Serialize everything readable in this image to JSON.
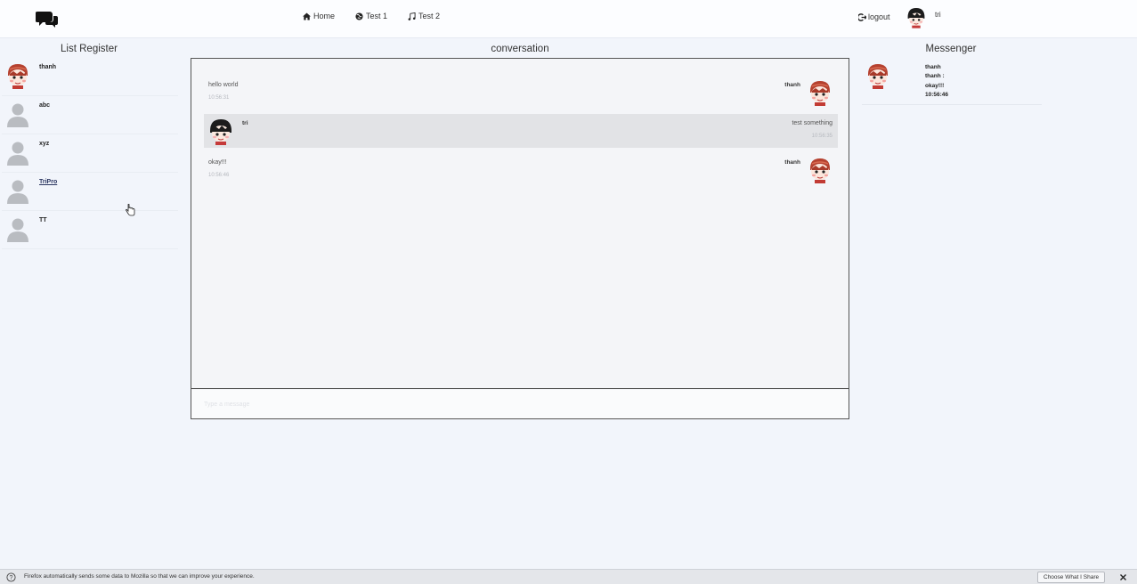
{
  "navbar": {
    "brand_icon": "chat-bubbles-icon",
    "links": [
      {
        "label": "Home",
        "icon": "home-icon"
      },
      {
        "label": "Test 1",
        "icon": "globe-icon"
      },
      {
        "label": "Test 2",
        "icon": "music-icon"
      }
    ],
    "logout_label": "logout",
    "user_name": "tri"
  },
  "list_register": {
    "title": "List Register",
    "items": [
      {
        "name": "thanh",
        "avatar": "cartoon-avatar-red"
      },
      {
        "name": "abc",
        "avatar": "default-user-icon"
      },
      {
        "name": "xyz",
        "avatar": "default-user-icon"
      },
      {
        "name": "TriPro",
        "avatar": "default-user-icon"
      },
      {
        "name": "TT",
        "avatar": "default-user-icon"
      }
    ]
  },
  "conversation": {
    "title": "conversation",
    "messages": [
      {
        "text": "hello world",
        "time": "10:56:31",
        "sender": "thanh",
        "side": "right-avatar"
      },
      {
        "text": "test something",
        "time": "10:56:35",
        "sender": "tri",
        "side": "left-avatar"
      },
      {
        "text": "okay!!!",
        "time": "10:56:46",
        "sender": "thanh",
        "side": "right-avatar"
      }
    ],
    "input_placeholder": "Type a message"
  },
  "messenger": {
    "title": "Messenger",
    "item": {
      "name": "thanh",
      "preview_from": "thanh :",
      "preview_text": "okay!!!",
      "time": "10:56:46"
    }
  },
  "firefox_bar": {
    "message": "Firefox automatically sends some data to Mozilla so that we can improve your experience.",
    "choose_label": "Choose What I Share"
  },
  "colors": {
    "page_bg": "#f2f5fb",
    "navbar_bg": "#fcfdff",
    "highlight_row": "#e2e3e6"
  }
}
